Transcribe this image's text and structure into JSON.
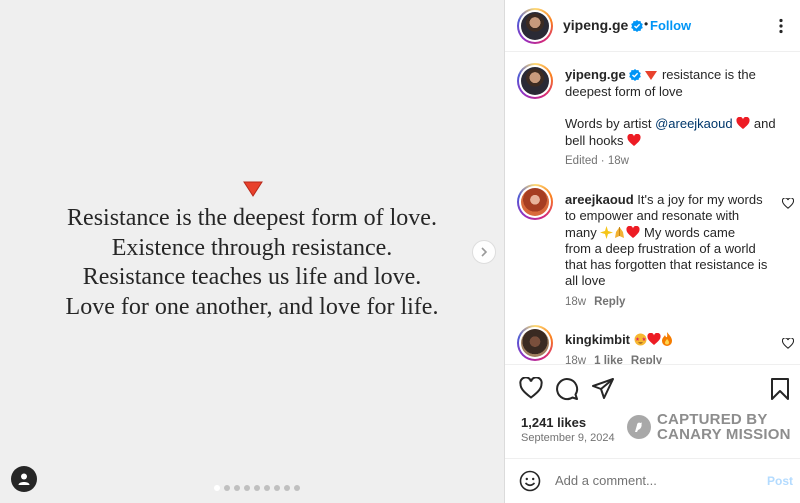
{
  "post": {
    "quote_lines": [
      "Resistance is the deepest form of love.",
      "Existence through resistance.",
      "Resistance teaches us life and love.",
      "Love for one another, and love for life."
    ],
    "carousel_dots": 9,
    "active_dot": 0
  },
  "header": {
    "username": "yipeng.ge",
    "separator": "•",
    "follow_label": "Follow"
  },
  "caption": {
    "username": "yipeng.ge",
    "text_a": "resistance is the",
    "text_b": "deepest form of love",
    "words_prefix": "Words by artist",
    "mention": "@areejkaoud",
    "and_text": "and",
    "bell_hooks": "bell hooks",
    "meta": "Edited · 18w"
  },
  "comments": [
    {
      "username": "areejkaoud",
      "line1": "It's a joy for my words",
      "line2": "to empower and resonate with",
      "line3_prefix": "many",
      "line3_suffix": "My words came",
      "line4": "from a deep frustration of a world",
      "line5": "that has forgotten that resistance is",
      "line6": "all love",
      "time": "18w",
      "reply": "Reply"
    },
    {
      "username": "kingkimbit",
      "time": "18w",
      "likes": "1 like",
      "reply": "Reply"
    }
  ],
  "stats": {
    "likes": "1,241 likes",
    "date": "September 9, 2024"
  },
  "watermark": {
    "line1": "CAPTURED BY",
    "line2": "CANARY MISSION"
  },
  "add_comment": {
    "placeholder": "Add a comment...",
    "post_label": "Post"
  },
  "colors": {
    "follow_blue": "#0095f6",
    "verified_blue": "#0095f6",
    "heart_red": "#ed4956",
    "post_disabled": "#b3dbff"
  }
}
